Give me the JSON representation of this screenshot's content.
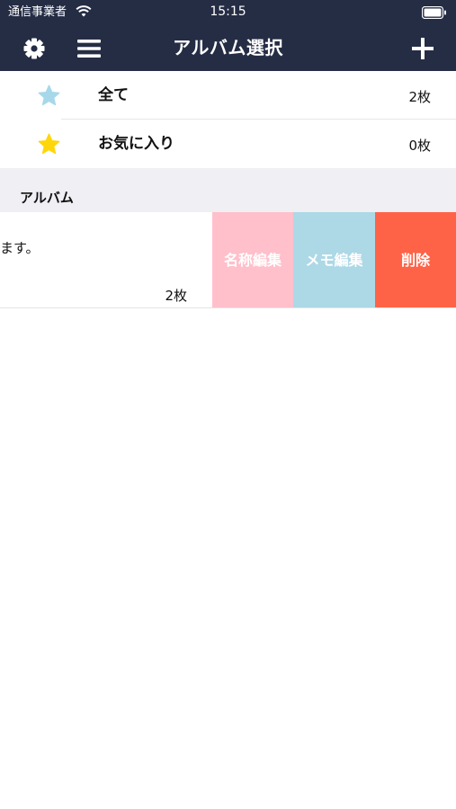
{
  "status_bar": {
    "carrier": "通信事業者",
    "time": "15:15",
    "icons": {
      "wifi": "wifi-icon",
      "battery": "battery-icon"
    }
  },
  "nav_bar": {
    "title": "アルバム選択",
    "background": "#252d45",
    "icons": {
      "settings": "gear-icon",
      "menu": "hamburger-menu-icon",
      "add": "plus-icon"
    }
  },
  "fixed_albums": [
    {
      "label": "全て",
      "count": "2枚",
      "icon": "star-icon",
      "icon_color": "#a7d8ea"
    },
    {
      "label": "お気に入り",
      "count": "0枚",
      "icon": "star-icon",
      "icon_color": "#ffd60a"
    }
  ],
  "section": {
    "title": "アルバム",
    "background": "#efeff4"
  },
  "albums": [
    {
      "description_visible": "ます。",
      "count": "2枚",
      "actions": [
        {
          "label": "名称編集",
          "color": "#ffc0cb"
        },
        {
          "label": "メモ編集",
          "color": "#add8e6"
        },
        {
          "label": "削除",
          "color": "#ff6347"
        }
      ]
    }
  ]
}
